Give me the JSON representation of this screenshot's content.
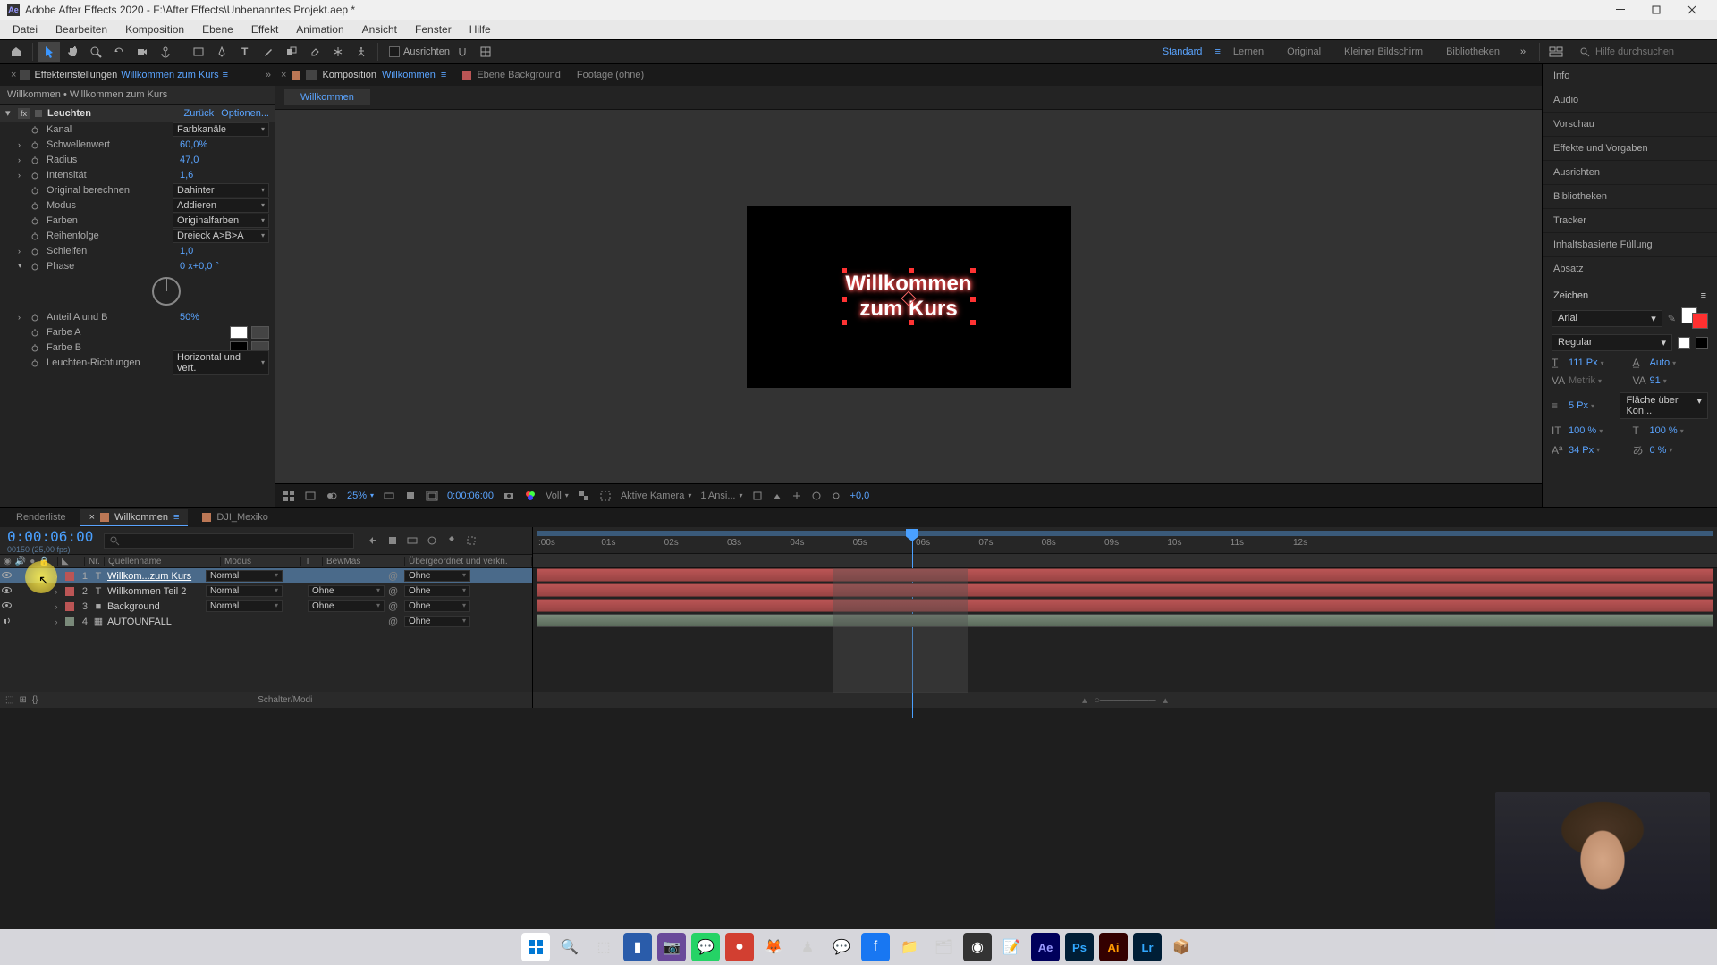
{
  "titlebar": {
    "app_icon": "Ae",
    "title": "Adobe After Effects 2020 - F:\\After Effects\\Unbenanntes Projekt.aep *"
  },
  "menubar": [
    "Datei",
    "Bearbeiten",
    "Komposition",
    "Ebene",
    "Effekt",
    "Animation",
    "Ansicht",
    "Fenster",
    "Hilfe"
  ],
  "toolbar": {
    "align_label": "Ausrichten",
    "workspaces": [
      "Standard",
      "Lernen",
      "Original",
      "Kleiner Bildschirm",
      "Bibliotheken"
    ],
    "active_workspace": 0,
    "search_placeholder": "Hilfe durchsuchen"
  },
  "effect_controls": {
    "tab_label": "Effekteinstellungen",
    "tab_link": "Willkommen zum Kurs",
    "breadcrumb": "Willkommen • Willkommen zum Kurs",
    "effect_name": "Leuchten",
    "back_link": "Zurück",
    "options_link": "Optionen...",
    "props": {
      "kanal": {
        "label": "Kanal",
        "value": "Farbkanäle"
      },
      "schwellenwert": {
        "label": "Schwellenwert",
        "value": "60,0%"
      },
      "radius": {
        "label": "Radius",
        "value": "47,0"
      },
      "intensitat": {
        "label": "Intensität",
        "value": "1,6"
      },
      "original": {
        "label": "Original berechnen",
        "value": "Dahinter"
      },
      "modus": {
        "label": "Modus",
        "value": "Addieren"
      },
      "farben": {
        "label": "Farben",
        "value": "Originalfarben"
      },
      "reihenfolge": {
        "label": "Reihenfolge",
        "value": "Dreieck A>B>A"
      },
      "schleifen": {
        "label": "Schleifen",
        "value": "1,0"
      },
      "phase": {
        "label": "Phase",
        "value": "0 x+0,0 °"
      },
      "anteil": {
        "label": "Anteil A und B",
        "value": "50%"
      },
      "farbe_a": {
        "label": "Farbe A"
      },
      "farbe_b": {
        "label": "Farbe B"
      },
      "richtungen": {
        "label": "Leuchten-Richtungen",
        "value": "Horizontal und vert."
      }
    }
  },
  "composition": {
    "tab_label": "Komposition",
    "tab_link": "Willkommen",
    "ebene_tab": "Ebene Background",
    "footage_tab": "Footage (ohne)",
    "subtab": "Willkommen",
    "text_line1": "Willkommen",
    "text_line2": "zum Kurs",
    "zoom": "25%",
    "timecode": "0:00:06:00",
    "resolution": "Voll",
    "camera": "Aktive Kamera",
    "view": "1 Ansi...",
    "exposure": "+0,0"
  },
  "right_panels": [
    "Info",
    "Audio",
    "Vorschau",
    "Effekte und Vorgaben",
    "Ausrichten",
    "Bibliotheken",
    "Tracker",
    "Inhaltsbasierte Füllung",
    "Absatz"
  ],
  "char_panel": {
    "title": "Zeichen",
    "font": "Arial",
    "style": "Regular",
    "size": "111 Px",
    "leading": "Auto",
    "kerning": "Metrik",
    "tracking": "91",
    "stroke": "5 Px",
    "stroke_opt": "Fläche über Kon...",
    "vscale": "100 %",
    "hscale": "100 %",
    "baseline": "34 Px",
    "tsume": "0 %",
    "fill_color": "#ffffff",
    "stroke_color": "#ff3030"
  },
  "timeline": {
    "tabs": {
      "render": "Renderliste",
      "willkommen": "Willkommen",
      "dji": "DJI_Mexiko"
    },
    "timecode": "0:00:06:00",
    "framerate": "00150 (25,00 fps)",
    "col_headers": {
      "nr": "Nr.",
      "quellenname": "Quellenname",
      "modus": "Modus",
      "t": "T",
      "bewmas": "BewMas",
      "parent": "Übergeordnet und verkn."
    },
    "layers": [
      {
        "num": "1",
        "type": "T",
        "name": "Willkom...zum Kurs",
        "mode": "Normal",
        "bewmas": "",
        "parent": "Ohne",
        "color": "#bb5555",
        "selected": true,
        "eye": true
      },
      {
        "num": "2",
        "type": "T",
        "name": "Willkommen Teil 2",
        "mode": "Normal",
        "bewmas": "Ohne",
        "parent": "Ohne",
        "color": "#bb5555",
        "selected": false,
        "eye": true
      },
      {
        "num": "3",
        "type": "",
        "name": "Background",
        "mode": "Normal",
        "bewmas": "Ohne",
        "parent": "Ohne",
        "color": "#bb5555",
        "selected": false,
        "eye": true
      },
      {
        "num": "4",
        "type": "",
        "name": "AUTOUNFALL",
        "mode": "",
        "bewmas": "",
        "parent": "Ohne",
        "color": "#7a8a7a",
        "selected": false,
        "eye": false
      }
    ],
    "footer": "Schalter/Modi",
    "ruler_ticks": [
      ":00s",
      "01s",
      "02s",
      "03s",
      "04s",
      "05s",
      "06s",
      "07s",
      "08s",
      "09s",
      "10s",
      "11s",
      "12s"
    ]
  }
}
